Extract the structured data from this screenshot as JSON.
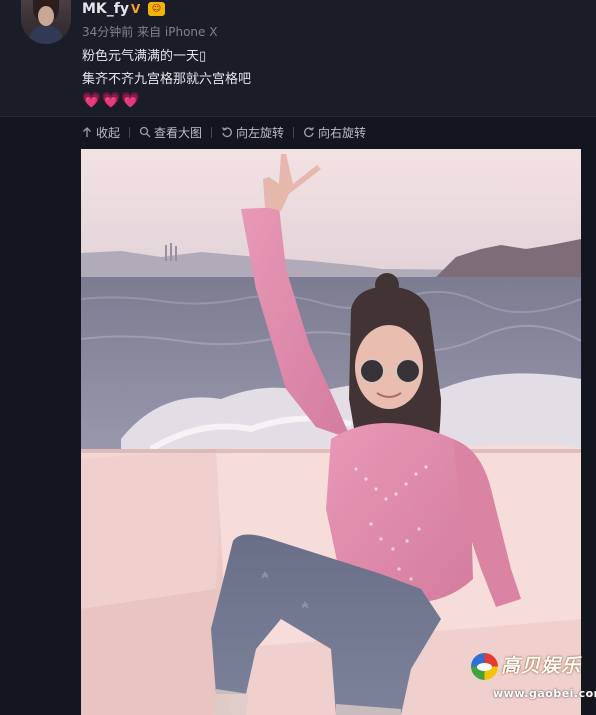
{
  "post": {
    "username": "MK_fy",
    "verified_icon": "verified-v-icon",
    "level_icon": "vip-level-icon",
    "meta": "34分钟前 来自 iPhone X",
    "text_line1": "粉色元气满满的一天▯",
    "text_line2": "集齐不齐九宫格那就六宫格吧",
    "emoji": "💗💗💗"
  },
  "toolbar": {
    "collapse_label": "收起",
    "view_large_label": "查看大图",
    "rotate_left_label": "向左旋转",
    "rotate_right_label": "向右旋转"
  },
  "watermark": {
    "brand": "高贝娱乐",
    "url": "www.gaobei.com"
  },
  "colors": {
    "background": "#14161f",
    "header_bg": "#1a1c27",
    "accent": "#ff8200",
    "heart": "#ff5cc8"
  }
}
